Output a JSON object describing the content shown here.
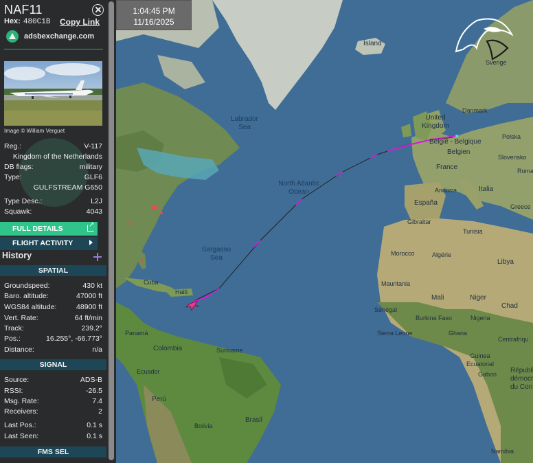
{
  "aircraft": {
    "callsign": "NAF11",
    "hex_label": "Hex:",
    "hex": "480C1B",
    "copy_link": "Copy Link",
    "source_site": "adsbexchange.com",
    "photo_credit": "Image © William Verguet"
  },
  "details": {
    "reg_label": "Reg.:",
    "reg": "V-117",
    "country": "Kingdom of the Netherlands",
    "dbflags_label": "DB flags:",
    "dbflags": "military",
    "type_label": "Type:",
    "type": "GLF6",
    "model": "GULFSTREAM G650",
    "typedesc_label": "Type Desc.:",
    "typedesc": "L2J",
    "squawk_label": "Squawk:",
    "squawk": "4043"
  },
  "buttons": {
    "full_details": "FULL DETAILS",
    "flight_activity": "FLIGHT ACTIVITY"
  },
  "history": {
    "label": "History"
  },
  "spatial": {
    "header": "SPATIAL",
    "groundspeed_label": "Groundspeed:",
    "groundspeed": "430 kt",
    "baro_label": "Baro. altitude:",
    "baro": "47000 ft",
    "wgs_label": "WGS84 altitude:",
    "wgs": "48900 ft",
    "vrate_label": "Vert. Rate:",
    "vrate": "64 ft/min",
    "track_label": "Track:",
    "track": "239.2°",
    "pos_label": "Pos.:",
    "pos": "16.255°, -66.773°",
    "distance_label": "Distance:",
    "distance": "n/a"
  },
  "signal": {
    "header": "SIGNAL",
    "source_label": "Source:",
    "source": "ADS-B",
    "rssi_label": "RSSI:",
    "rssi": "-26.5",
    "msgrate_label": "Msg. Rate:",
    "msgrate": "7.4",
    "receivers_label": "Receivers:",
    "receivers": "2",
    "lastpos_label": "Last Pos.:",
    "lastpos": "0.1 s",
    "lastseen_label": "Last Seen:",
    "lastseen": "0.1 s"
  },
  "fms": {
    "header": "FMS SEL"
  },
  "clock": {
    "time": "1:04:45 PM",
    "date": "11/16/2025"
  },
  "map_labels": {
    "island": "Island",
    "labrador_1": "Labrador",
    "labrador_2": "Sea",
    "north_atlantic_1": "North Atlantic",
    "north_atlantic_2": "Ocean",
    "sargasso_1": "Sargasso",
    "sargasso_2": "Sea",
    "sverige": "Sverige",
    "danmark": "Danmark",
    "united_kingdom_1": "United",
    "united_kingdom_2": "Kingdom",
    "belgique": "België - Belgique",
    "belgien": "Belgien",
    "polska": "Polska",
    "france": "France",
    "slovensko": "Slovensko",
    "andorra": "Andorra",
    "italia": "Italia",
    "roma": "Roma",
    "espana": "España",
    "gibraltar": "Gibraltar",
    "greece": "Greece",
    "tunisia": "Tunisia",
    "morocco": "Morocco",
    "algerie": "Algérie",
    "libya": "Libya",
    "mauritania": "Mauritania",
    "mali": "Mali",
    "niger": "Niger",
    "chad": "Chad",
    "senegal": "Sénégal",
    "burkina": "Burkina Faso",
    "nigeria": "Nigeria",
    "sierra_leone": "Sierra Leone",
    "ghana": "Ghana",
    "centrafrique": "Centrafriqu",
    "guinea": "Guinea",
    "ecuatorial": "Ecuatorial",
    "gabon": "Gabon",
    "rdc_1": "République",
    "rdc_2": "démocrat",
    "rdc_3": "du Con",
    "haiti": "Haiti",
    "cuba": "Cuba",
    "panama": "Panamá",
    "colombia": "Colombia",
    "suriname": "Suriname",
    "ecuador": "Ecuador",
    "peru": "Perú",
    "brasil": "Brasil",
    "bolivia": "Bolivia",
    "namibia": "Namibia"
  },
  "colors": {
    "sidebar_bg": "#2a2b2d",
    "accent_green": "#2ec48a",
    "section_teal": "#1d4756",
    "track_magenta": "#d21ed2",
    "ocean": "#3f6d96",
    "land": "#8c9a6c"
  }
}
